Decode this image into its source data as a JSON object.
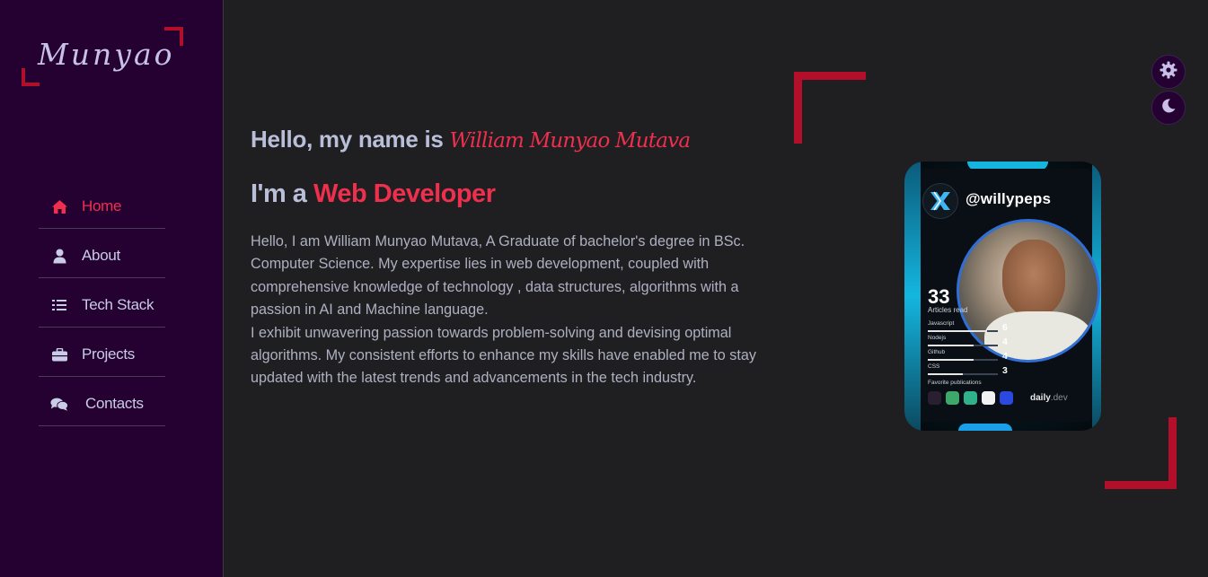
{
  "logo": {
    "text": "Munyao"
  },
  "nav": {
    "items": [
      {
        "label": "Home",
        "icon": "home-icon",
        "active": true
      },
      {
        "label": "About",
        "icon": "user-icon",
        "active": false
      },
      {
        "label": "Tech Stack",
        "icon": "list-icon",
        "active": false
      },
      {
        "label": "Projects",
        "icon": "briefcase-icon",
        "active": false
      },
      {
        "label": "Contacts",
        "icon": "comments-icon",
        "active": false
      }
    ]
  },
  "intro": {
    "greeting": "Hello, my name is",
    "name": "William Munyao Mutava",
    "role_prefix": "I'm a",
    "role": "Web Developer",
    "bio_lines": [
      "Hello, I am William Munyao Mutava, A Graduate of bachelor's degree in BSc.",
      "Computer Science. My expertise lies in web development, coupled with",
      "comprehensive knowledge of technology , data structures, algorithms with a",
      "passion in AI and Machine language.",
      "I exhibit unwavering passion towards problem-solving and devising optimal",
      "algorithms. My consistent efforts to enhance my skills have enabled me to stay",
      "updated with the latest trends and advancements in the tech industry."
    ]
  },
  "card": {
    "handle": "@willypeps",
    "articles_count": "33",
    "articles_label": "Articles read",
    "stats": [
      {
        "label": "Javascript",
        "value": "6",
        "fraction": 0.85
      },
      {
        "label": "Nodejs",
        "value": "4",
        "fraction": 0.65
      },
      {
        "label": "Github",
        "value": "4",
        "fraction": 0.65
      },
      {
        "label": "CSS",
        "value": "3",
        "fraction": 0.5
      }
    ],
    "favorites_label": "Favorite publications",
    "brand": "daily",
    "brand_suffix": ".dev"
  },
  "controls": {
    "settings": "gear-icon",
    "theme": "moon-icon"
  },
  "colors": {
    "accent": "#ee2f4e",
    "sidebar": "#250132",
    "bracket": "#b40f2a",
    "background": "#1f1f21"
  }
}
